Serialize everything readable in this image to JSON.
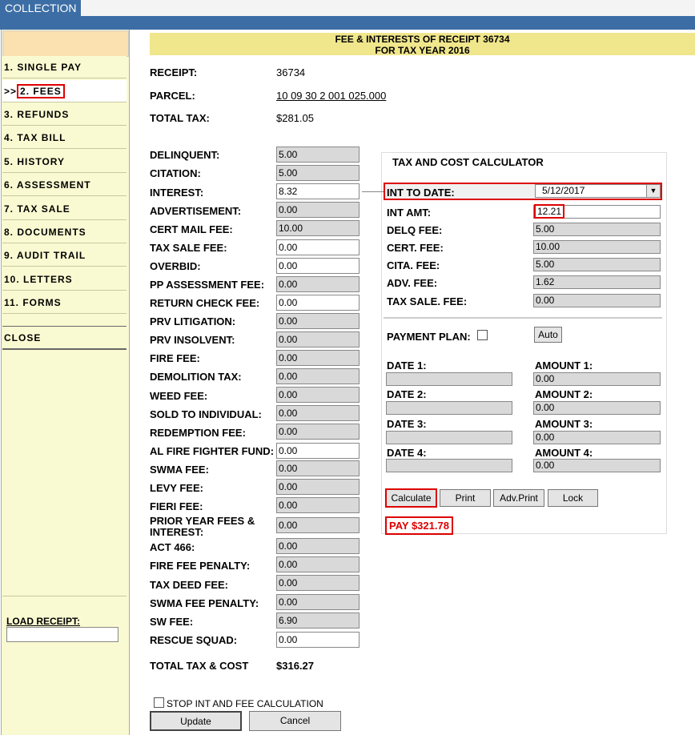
{
  "app": {
    "tab_label": "COLLECTION"
  },
  "sidebar": {
    "items": [
      {
        "label": "1. SINGLE PAY"
      },
      {
        "label": "2. FEES",
        "prefix": ">>"
      },
      {
        "label": "3. REFUNDS"
      },
      {
        "label": "4. TAX BILL"
      },
      {
        "label": "5. HISTORY"
      },
      {
        "label": "6. ASSESSMENT"
      },
      {
        "label": "7. TAX SALE"
      },
      {
        "label": "8. DOCUMENTS"
      },
      {
        "label": "9. AUDIT TRAIL"
      },
      {
        "label": "10. LETTERS"
      },
      {
        "label": "11. FORMS"
      }
    ],
    "close_label": "CLOSE",
    "load_receipt_label": "LOAD RECEIPT:",
    "load_receipt_value": ""
  },
  "header": {
    "line1": "FEE & INTERESTS OF RECEIPT 36734",
    "line2": "FOR TAX YEAR 2016"
  },
  "info": {
    "receipt_label": "RECEIPT:",
    "receipt_value": "36734",
    "parcel_label": "PARCEL:",
    "parcel_value": "10 09 30 2 001 025.000",
    "total_tax_label": "TOTAL TAX:",
    "total_tax_value": "$281.05"
  },
  "fees": [
    {
      "label": "DELINQUENT:",
      "value": "5.00",
      "editable": false
    },
    {
      "label": "CITATION:",
      "value": "5.00",
      "editable": false
    },
    {
      "label": "INTEREST:",
      "value": "8.32",
      "editable": true
    },
    {
      "label": "ADVERTISEMENT:",
      "value": "0.00",
      "editable": false
    },
    {
      "label": "CERT MAIL FEE:",
      "value": "10.00",
      "editable": false
    },
    {
      "label": "TAX SALE FEE:",
      "value": "0.00",
      "editable": true
    },
    {
      "label": "OVERBID:",
      "value": "0.00",
      "editable": true
    },
    {
      "label": "PP ASSESSMENT FEE:",
      "value": "0.00",
      "editable": false
    },
    {
      "label": "RETURN CHECK FEE:",
      "value": "0.00",
      "editable": true
    },
    {
      "label": "PRV LITIGATION:",
      "value": "0.00",
      "editable": false
    },
    {
      "label": "PRV INSOLVENT:",
      "value": "0.00",
      "editable": false
    },
    {
      "label": "FIRE FEE:",
      "value": "0.00",
      "editable": false
    },
    {
      "label": "DEMOLITION TAX:",
      "value": "0.00",
      "editable": false
    },
    {
      "label": "WEED FEE:",
      "value": "0.00",
      "editable": false
    },
    {
      "label": "SOLD TO INDIVIDUAL:",
      "value": "0.00",
      "editable": false
    },
    {
      "label": "REDEMPTION FEE:",
      "value": "0.00",
      "editable": false
    },
    {
      "label": "AL FIRE FIGHTER FUND:",
      "value": "0.00",
      "editable": true
    },
    {
      "label": "SWMA FEE:",
      "value": "0.00",
      "editable": false
    },
    {
      "label": "LEVY FEE:",
      "value": "0.00",
      "editable": false
    },
    {
      "label": "FIERI FEE:",
      "value": "0.00",
      "editable": false
    },
    {
      "label": "PRIOR YEAR FEES & INTEREST:",
      "value": "0.00",
      "editable": false
    },
    {
      "label": "ACT 466:",
      "value": "0.00",
      "editable": false
    },
    {
      "label": "FIRE FEE PENALTY:",
      "value": "0.00",
      "editable": false
    },
    {
      "label": "TAX DEED FEE:",
      "value": "0.00",
      "editable": false
    },
    {
      "label": "SWMA FEE PENALTY:",
      "value": "0.00",
      "editable": false
    },
    {
      "label": "SW FEE:",
      "value": "6.90",
      "editable": false
    },
    {
      "label": "RESCUE SQUAD:",
      "value": "0.00",
      "editable": true
    }
  ],
  "total": {
    "label": "TOTAL TAX & COST",
    "value": "$316.27"
  },
  "bottom": {
    "stop_label": "STOP INT AND FEE CALCULATION",
    "update_label": "Update",
    "cancel_label": "Cancel"
  },
  "calculator": {
    "title": "TAX AND COST CALCULATOR",
    "int_to_date_label": "INT TO DATE:",
    "int_to_date_value": "5/12/2017",
    "int_amt_label": "INT AMT:",
    "int_amt_value": "12.21",
    "rows": [
      {
        "label": "DELQ FEE:",
        "value": "5.00"
      },
      {
        "label": "CERT. FEE:",
        "value": "10.00"
      },
      {
        "label": "CITA. FEE:",
        "value": "5.00"
      },
      {
        "label": "ADV. FEE:",
        "value": "1.62"
      },
      {
        "label": "TAX SALE. FEE:",
        "value": "0.00"
      }
    ],
    "payment_plan_label": "PAYMENT PLAN:",
    "auto_label": "Auto",
    "plan": [
      {
        "date_label": "DATE 1:",
        "date_value": "",
        "amount_label": "AMOUNT 1:",
        "amount_value": "0.00"
      },
      {
        "date_label": "DATE 2:",
        "date_value": "",
        "amount_label": "AMOUNT 2:",
        "amount_value": "0.00"
      },
      {
        "date_label": "DATE 3:",
        "date_value": "",
        "amount_label": "AMOUNT 3:",
        "amount_value": "0.00"
      },
      {
        "date_label": "DATE 4:",
        "date_value": "",
        "amount_label": "AMOUNT 4:",
        "amount_value": "0.00"
      }
    ],
    "buttons": {
      "calculate": "Calculate",
      "print": "Print",
      "adv_print": "Adv.Print",
      "lock": "Lock"
    },
    "pay_text": "PAY $321.78"
  }
}
